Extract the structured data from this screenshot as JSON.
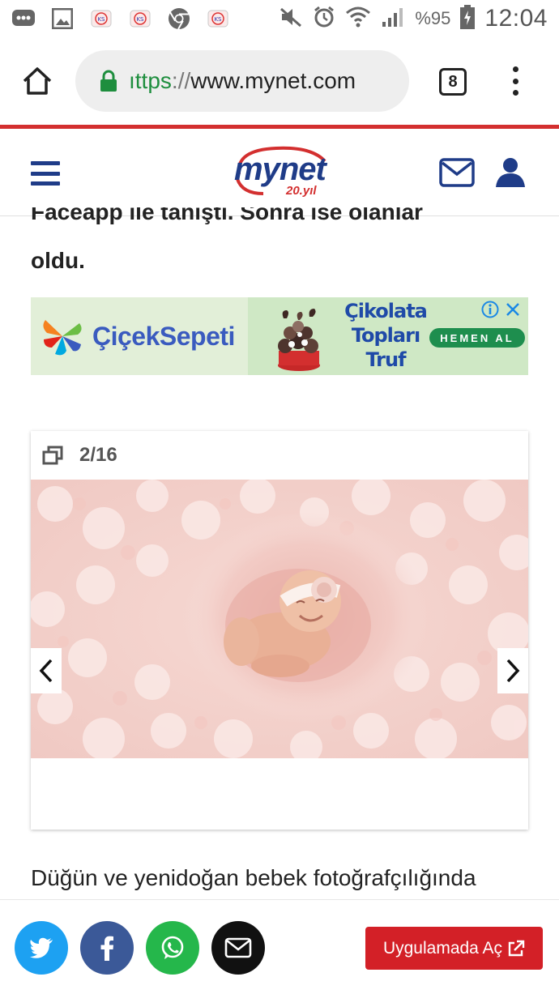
{
  "status_bar": {
    "battery_percent": "%95",
    "time": "12:04"
  },
  "browser": {
    "url_scheme": "ıttps",
    "url_sep": "://",
    "url_host": "www.mynet.com",
    "tab_count": "8"
  },
  "site": {
    "logo_word": "mynet",
    "logo_sub": "20.yıl"
  },
  "article": {
    "cut_line": "Faceapp ile tanıştı. Sonra ise olanlar",
    "line": "oldu.",
    "next_paragraph": "Düğün ve yenidoğan bebek fotoğrafçılığında"
  },
  "ad": {
    "brand": "ÇiçekSepeti",
    "copy_line1": "Çikolata",
    "copy_line2": "Topları",
    "copy_line3": "Truf Buketi",
    "cta": "HEMEN AL"
  },
  "gallery": {
    "counter": "2/16"
  },
  "bottom_bar": {
    "open_app_label": "Uygulamada Aç"
  },
  "colors": {
    "brand_blue": "#1f3c88",
    "brand_red": "#d32f2f",
    "twitter": "#1da1f2",
    "facebook": "#3b5998",
    "whatsapp": "#25b74b",
    "mail": "#111111",
    "app_button": "#d32027"
  }
}
